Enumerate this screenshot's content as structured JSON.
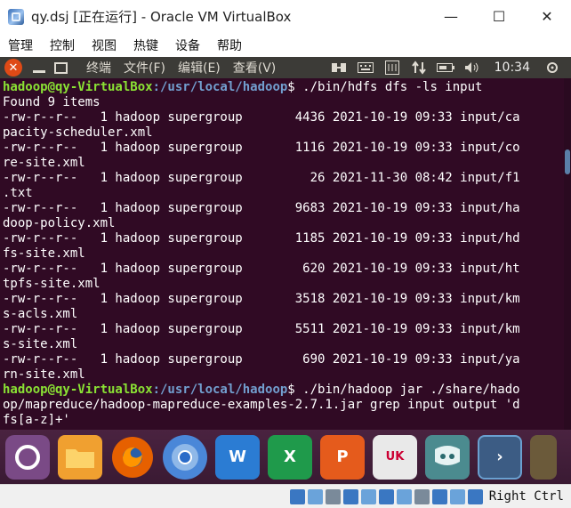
{
  "window": {
    "title": "qy.dsj [正在运行] - Oracle VM VirtualBox",
    "minimize": "—",
    "maximize": "☐",
    "close": "✕"
  },
  "vbox_menu": [
    "管理",
    "控制",
    "视图",
    "热键",
    "设备",
    "帮助"
  ],
  "ubuntu_panel": {
    "close_symbol": "✕",
    "menus": [
      "终端",
      "文件(F)",
      "编辑(E)",
      "查看(V)"
    ],
    "time": "10:34"
  },
  "terminal": {
    "lines": [
      {
        "user": "hadoop@qy-VirtualBox",
        "path": ":/usr/local/hadoop",
        "cmd": "$ ./bin/hdfs dfs -ls input"
      },
      {
        "text": "Found 9 items"
      },
      {
        "text": "-rw-r--r--   1 hadoop supergroup       4436 2021-10-19 09:33 input/ca"
      },
      {
        "text": "pacity-scheduler.xml"
      },
      {
        "text": "-rw-r--r--   1 hadoop supergroup       1116 2021-10-19 09:33 input/co"
      },
      {
        "text": "re-site.xml"
      },
      {
        "text": "-rw-r--r--   1 hadoop supergroup         26 2021-11-30 08:42 input/f1"
      },
      {
        "text": ".txt"
      },
      {
        "text": "-rw-r--r--   1 hadoop supergroup       9683 2021-10-19 09:33 input/ha"
      },
      {
        "text": "doop-policy.xml"
      },
      {
        "text": "-rw-r--r--   1 hadoop supergroup       1185 2021-10-19 09:33 input/hd"
      },
      {
        "text": "fs-site.xml"
      },
      {
        "text": "-rw-r--r--   1 hadoop supergroup        620 2021-10-19 09:33 input/ht"
      },
      {
        "text": "tpfs-site.xml"
      },
      {
        "text": "-rw-r--r--   1 hadoop supergroup       3518 2021-10-19 09:33 input/km"
      },
      {
        "text": "s-acls.xml"
      },
      {
        "text": "-rw-r--r--   1 hadoop supergroup       5511 2021-10-19 09:33 input/km"
      },
      {
        "text": "s-site.xml"
      },
      {
        "text": "-rw-r--r--   1 hadoop supergroup        690 2021-10-19 09:33 input/ya"
      },
      {
        "text": "rn-site.xml"
      },
      {
        "user": "hadoop@qy-VirtualBox",
        "path": ":/usr/local/hadoop",
        "cmd": "$ ./bin/hadoop jar ./share/hado"
      },
      {
        "text": "op/mapreduce/hadoop-mapreduce-examples-2.7.1.jar grep input output 'd"
      },
      {
        "text": "fs[a-z]+'"
      }
    ]
  },
  "launcher": {
    "items": [
      {
        "name": "ubuntu-dash",
        "label": ""
      },
      {
        "name": "files",
        "label": ""
      },
      {
        "name": "firefox",
        "label": ""
      },
      {
        "name": "chromium",
        "label": ""
      },
      {
        "name": "wps-writer",
        "label": "W"
      },
      {
        "name": "wps-spreadsheets",
        "label": "X"
      },
      {
        "name": "wps-presentation",
        "label": "P"
      },
      {
        "name": "software-center",
        "label": "UK"
      },
      {
        "name": "settings",
        "label": ""
      },
      {
        "name": "terminal",
        "label": "›"
      },
      {
        "name": "more",
        "label": ""
      }
    ]
  },
  "vbox_status": {
    "host_key": "Right Ctrl"
  }
}
